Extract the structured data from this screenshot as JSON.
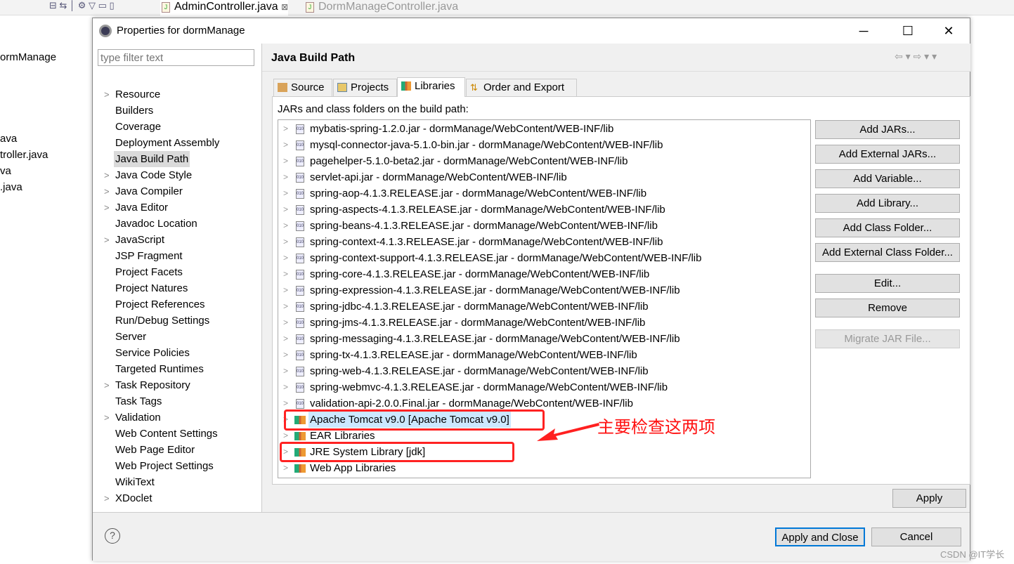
{
  "editor": {
    "tabs": [
      {
        "label": "AdminController.java",
        "active": true
      },
      {
        "label": "DormManageController.java",
        "active": false
      }
    ],
    "close_glyph": "⊠"
  },
  "workspace": {
    "items": [
      "ormManage",
      "ava",
      "troller.java",
      "va",
      ".java"
    ]
  },
  "dialog": {
    "title": "Properties for dormManage",
    "filter_placeholder": "type filter text",
    "nav": [
      {
        "label": "Resource",
        "expandable": true
      },
      {
        "label": "Builders"
      },
      {
        "label": "Coverage"
      },
      {
        "label": "Deployment Assembly"
      },
      {
        "label": "Java Build Path",
        "selected": true
      },
      {
        "label": "Java Code Style",
        "expandable": true
      },
      {
        "label": "Java Compiler",
        "expandable": true
      },
      {
        "label": "Java Editor",
        "expandable": true
      },
      {
        "label": "Javadoc Location"
      },
      {
        "label": "JavaScript",
        "expandable": true
      },
      {
        "label": "JSP Fragment"
      },
      {
        "label": "Project Facets"
      },
      {
        "label": "Project Natures"
      },
      {
        "label": "Project References"
      },
      {
        "label": "Run/Debug Settings"
      },
      {
        "label": "Server"
      },
      {
        "label": "Service Policies"
      },
      {
        "label": "Targeted Runtimes"
      },
      {
        "label": "Task Repository",
        "expandable": true
      },
      {
        "label": "Task Tags"
      },
      {
        "label": "Validation",
        "expandable": true
      },
      {
        "label": "Web Content Settings"
      },
      {
        "label": "Web Page Editor"
      },
      {
        "label": "Web Project Settings"
      },
      {
        "label": "WikiText"
      },
      {
        "label": "XDoclet",
        "expandable": true
      }
    ],
    "page_title": "Java Build Path",
    "tabs": [
      {
        "label": "Source"
      },
      {
        "label": "Projects"
      },
      {
        "label": "Libraries",
        "active": true
      },
      {
        "label": "Order and Export"
      }
    ],
    "list_label": "JARs and class folders on the build path:",
    "entries": [
      {
        "text": "mybatis-spring-1.2.0.jar - dormManage/WebContent/WEB-INF/lib",
        "kind": "jar"
      },
      {
        "text": "mysql-connector-java-5.1.0-bin.jar - dormManage/WebContent/WEB-INF/lib",
        "kind": "jar"
      },
      {
        "text": "pagehelper-5.1.0-beta2.jar - dormManage/WebContent/WEB-INF/lib",
        "kind": "jar"
      },
      {
        "text": "servlet-api.jar - dormManage/WebContent/WEB-INF/lib",
        "kind": "jar"
      },
      {
        "text": "spring-aop-4.1.3.RELEASE.jar - dormManage/WebContent/WEB-INF/lib",
        "kind": "jar"
      },
      {
        "text": "spring-aspects-4.1.3.RELEASE.jar - dormManage/WebContent/WEB-INF/lib",
        "kind": "jar"
      },
      {
        "text": "spring-beans-4.1.3.RELEASE.jar - dormManage/WebContent/WEB-INF/lib",
        "kind": "jar"
      },
      {
        "text": "spring-context-4.1.3.RELEASE.jar - dormManage/WebContent/WEB-INF/lib",
        "kind": "jar"
      },
      {
        "text": "spring-context-support-4.1.3.RELEASE.jar - dormManage/WebContent/WEB-INF/lib",
        "kind": "jar"
      },
      {
        "text": "spring-core-4.1.3.RELEASE.jar - dormManage/WebContent/WEB-INF/lib",
        "kind": "jar"
      },
      {
        "text": "spring-expression-4.1.3.RELEASE.jar - dormManage/WebContent/WEB-INF/lib",
        "kind": "jar"
      },
      {
        "text": "spring-jdbc-4.1.3.RELEASE.jar - dormManage/WebContent/WEB-INF/lib",
        "kind": "jar"
      },
      {
        "text": "spring-jms-4.1.3.RELEASE.jar - dormManage/WebContent/WEB-INF/lib",
        "kind": "jar"
      },
      {
        "text": "spring-messaging-4.1.3.RELEASE.jar - dormManage/WebContent/WEB-INF/lib",
        "kind": "jar"
      },
      {
        "text": "spring-tx-4.1.3.RELEASE.jar - dormManage/WebContent/WEB-INF/lib",
        "kind": "jar"
      },
      {
        "text": "spring-web-4.1.3.RELEASE.jar - dormManage/WebContent/WEB-INF/lib",
        "kind": "jar"
      },
      {
        "text": "spring-webmvc-4.1.3.RELEASE.jar - dormManage/WebContent/WEB-INF/lib",
        "kind": "jar"
      },
      {
        "text": "validation-api-2.0.0.Final.jar - dormManage/WebContent/WEB-INF/lib",
        "kind": "jar"
      },
      {
        "text": "Apache Tomcat v9.0 [Apache Tomcat v9.0]",
        "kind": "library",
        "selected": true
      },
      {
        "text": "EAR Libraries",
        "kind": "library"
      },
      {
        "text": "JRE System Library [jdk]",
        "kind": "library"
      },
      {
        "text": "Web App Libraries",
        "kind": "library"
      }
    ],
    "side_buttons": [
      {
        "label": "Add JARs..."
      },
      {
        "label": "Add External JARs..."
      },
      {
        "label": "Add Variable..."
      },
      {
        "label": "Add Library..."
      },
      {
        "label": "Add Class Folder..."
      },
      {
        "label": "Add External Class Folder..."
      },
      {
        "label": "Edit..."
      },
      {
        "label": "Remove"
      },
      {
        "label": "Migrate JAR File...",
        "disabled": true
      }
    ],
    "apply": "Apply",
    "apply_close": "Apply and Close",
    "cancel": "Cancel"
  },
  "annotation": {
    "text": "主要检查这两项",
    "color": "#ff2020"
  },
  "watermark": "CSDN @IT学长"
}
